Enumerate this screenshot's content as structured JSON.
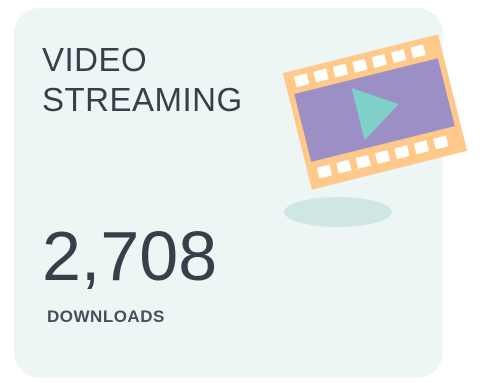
{
  "card": {
    "title_line1": "VIDEO",
    "title_line2": "STREAMING",
    "value": "2,708",
    "unit_label": "DOWNLOADS"
  },
  "illustration": {
    "icon": "film-strip-play-icon",
    "colors": {
      "frame": "#ffc98a",
      "screen": "#9b8fc5",
      "play": "#7fd0c9",
      "shadow": "#cfe7e4",
      "card_background": "#eef6f5",
      "text": "#3a3d4a"
    }
  }
}
